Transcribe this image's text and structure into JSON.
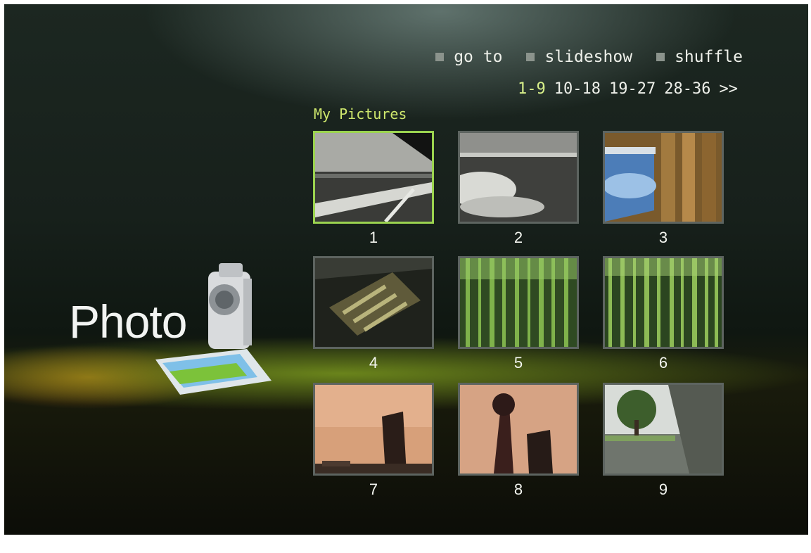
{
  "menu": [
    {
      "label": "go to",
      "icon": "square-bullet-icon"
    },
    {
      "label": "slideshow",
      "icon": "square-bullet-icon"
    },
    {
      "label": "shuffle",
      "icon": "square-bullet-icon"
    }
  ],
  "pages": {
    "current": "1-9",
    "others": [
      "10-18",
      "19-27",
      "28-36"
    ],
    "next": ">>"
  },
  "section_title": "My Pictures",
  "app_label": "Photo",
  "thumbnails": [
    {
      "number": "1",
      "selected": true
    },
    {
      "number": "2",
      "selected": false
    },
    {
      "number": "3",
      "selected": false
    },
    {
      "number": "4",
      "selected": false
    },
    {
      "number": "5",
      "selected": false
    },
    {
      "number": "6",
      "selected": false
    },
    {
      "number": "7",
      "selected": false
    },
    {
      "number": "8",
      "selected": false
    },
    {
      "number": "9",
      "selected": false
    }
  ],
  "colors": {
    "selection_border": "#9bd34f",
    "title_accent": "#cfe86d",
    "frame_border": "#5d6460"
  }
}
